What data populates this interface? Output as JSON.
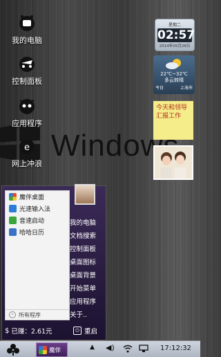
{
  "wallpaper": {
    "brand_text": "Windows"
  },
  "desktop_icons": [
    {
      "label": "我的电脑",
      "icon": "computer-icon"
    },
    {
      "label": "控制面板",
      "icon": "control-panel-icon"
    },
    {
      "label": "应用程序",
      "icon": "apps-icon"
    },
    {
      "label": "网上冲浪",
      "icon": "browser-icon"
    }
  ],
  "clock_widget": {
    "top_label": "星期二",
    "time": "02:57",
    "date": "2014年05月26日"
  },
  "weather_widget": {
    "temp": "22℃~32℃",
    "condition": "多云转晴",
    "day": "今日",
    "city": "上海市"
  },
  "note_widget": {
    "text": "今天和领导汇报工作"
  },
  "start_menu": {
    "programs": [
      {
        "label": "魔伴桌面",
        "icon": "pinwheel-icon",
        "color": "#e44a2a"
      },
      {
        "label": "光速输入法",
        "icon": "input-method-icon",
        "color": "#2b7dd6"
      },
      {
        "label": "音速启动",
        "icon": "launcher-icon",
        "color": "#3aa63a"
      },
      {
        "label": "哈哈日历",
        "icon": "calendar-icon",
        "color": "#3a72c8"
      }
    ],
    "all_programs": "所有程序",
    "links": [
      "我的电脑",
      "文档搜索",
      "控制面板",
      "桌面图标",
      "桌面背景",
      "开始菜单",
      "应用程序",
      "关于.."
    ],
    "earned": "已赚：2.61元",
    "restart": "重启"
  },
  "taskbar": {
    "app_label": "魔伴",
    "time": "17:12:32"
  }
}
